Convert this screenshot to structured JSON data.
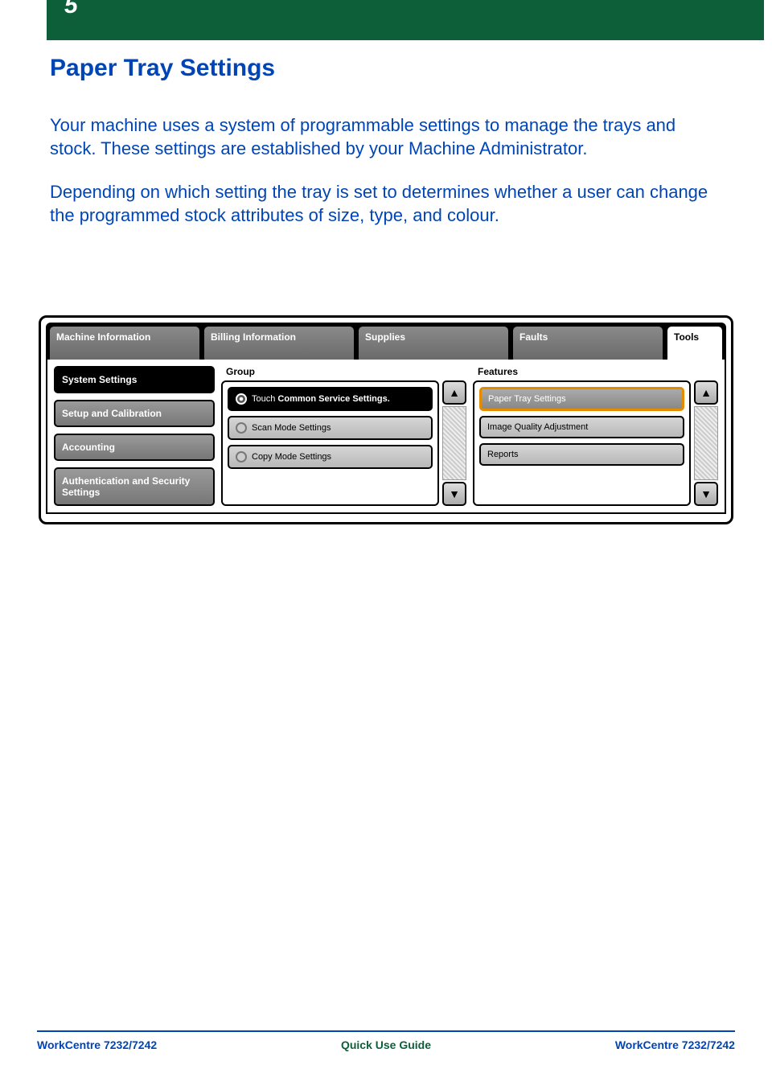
{
  "page_number": "5",
  "title": "Paper Tray Settings",
  "paragraphs": [
    "Your machine uses a system of programmable settings to manage the trays and stock. These settings are established by your Machine Administrator.",
    "Depending on which setting the tray is set to determines whether a user can change the programmed stock attributes of size, type, and colour."
  ],
  "tabs": {
    "machine_info": "Machine Information",
    "billing_info": "Billing Information",
    "supplies": "Supplies",
    "faults": "Faults",
    "tools": "Tools"
  },
  "left_buttons": {
    "system_settings": "System Settings",
    "setup_calibration": "Setup and Calibration",
    "accounting": "Accounting",
    "auth_security": "Authentication and Security Settings"
  },
  "group": {
    "header": "Group",
    "items": {
      "common_prefix": "Touch ",
      "common_bold": "Common Service Settings.",
      "scan": "Scan Mode Settings",
      "copy": "Copy Mode Settings"
    }
  },
  "features": {
    "header": "Features",
    "items": {
      "paper_tray": "Paper Tray Settings",
      "image_quality": "Image Quality Adjustment",
      "reports": "Reports"
    }
  },
  "footer": {
    "left": "WorkCentre 7232/7242",
    "center": "Quick Use Guide",
    "right": "WorkCentre 7232/7242"
  }
}
